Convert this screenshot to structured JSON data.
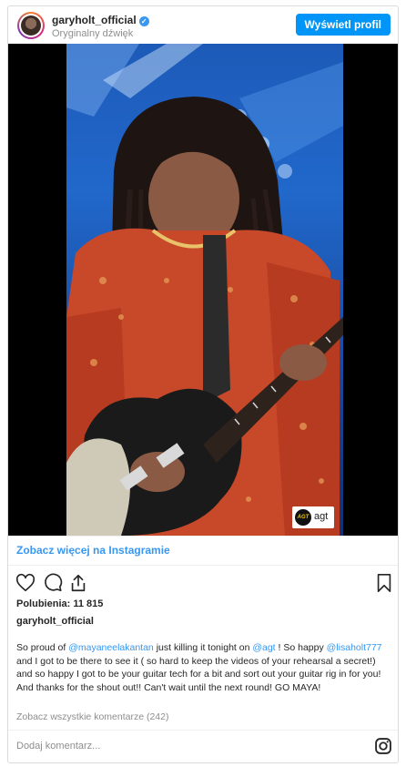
{
  "post": {
    "username": "garyholt_official",
    "verified_mark": "✓",
    "audio_label": "Oryginalny dźwięk",
    "view_profile_label": "Wyświetl profil"
  },
  "media": {
    "watermark_logo": "AGT",
    "watermark_text": "agt"
  },
  "see_more_label": "Zobacz więcej na Instagramie",
  "actions": {
    "icons": [
      "heart-icon",
      "comment-icon",
      "share-icon",
      "bookmark-icon"
    ]
  },
  "likes_text": "Polubienia: 11 815",
  "caption": {
    "username": "garyholt_official",
    "parts": [
      "So proud of ",
      "@mayaneelakantan",
      " just killing it tonight on ",
      "@agt",
      " ! So happy ",
      "@lisaholt777",
      " and I got to be there to see it ( so hard to keep the videos of your rehearsal a secret!) and so happy I got to be your guitar tech for a bit and sort out your guitar rig in for you! And thanks for the shout out!! Can't wait until the next round! GO MAYA!"
    ]
  },
  "view_comments_label": "Zobacz wszystkie komentarze (242)",
  "add_comment_placeholder": "Dodaj komentarz...",
  "colors": {
    "accent": "#3897f0",
    "button": "#0095f6",
    "muted": "#8e8e8e",
    "border": "#dbdbdb"
  }
}
